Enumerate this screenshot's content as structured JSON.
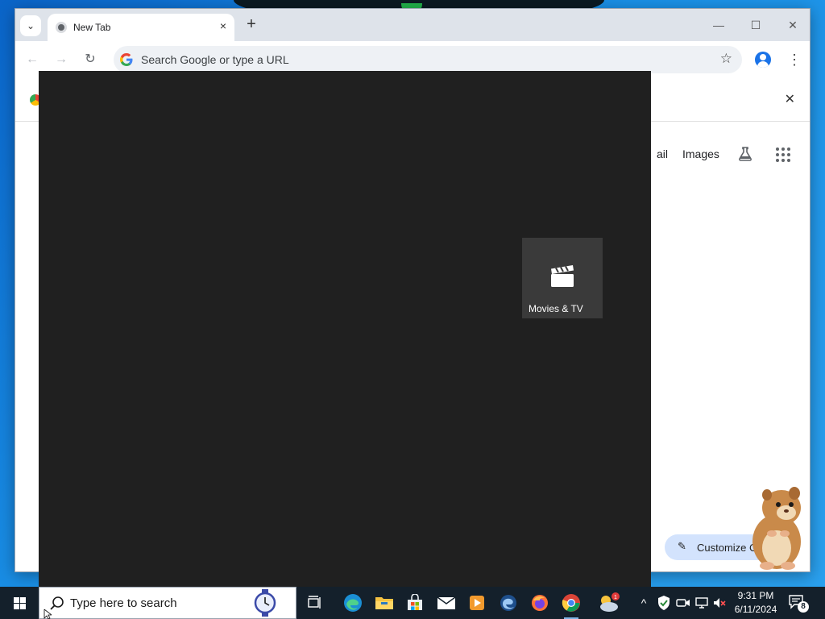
{
  "browser": {
    "tab": {
      "title": "New Tab",
      "close_glyph": "×"
    },
    "newtab_glyph": "+",
    "window_controls": {
      "minimize": "—",
      "maximize": "☐",
      "close": "✕"
    },
    "toolbar": {
      "back_glyph": "←",
      "forward_glyph": "→",
      "reload_glyph": "↻",
      "star_glyph": "☆",
      "menu_glyph": "⋮",
      "omnibox_placeholder": "Search Google or type a URL"
    },
    "page": {
      "promo_close_glyph": "✕",
      "partial_link": "ail",
      "images_link": "Images",
      "customize_label": "Customize Chr",
      "customize_glyph": "✎"
    }
  },
  "launcher": {
    "app_tile_label": "Movies & TV"
  },
  "taskbar": {
    "search_placeholder": "Type here to search",
    "clock_time": "9:31 PM",
    "clock_date": "6/11/2024",
    "notification_count": "8",
    "weather_badge": "1",
    "tray_chevron": "^"
  },
  "icons": [
    "tab-search-icon",
    "chrome-favicon",
    "google-g-icon",
    "bookmark-star-icon",
    "profile-icon",
    "kebab-menu-icon",
    "labs-flask-icon",
    "apps-grid-icon",
    "clapperboard-icon",
    "windows-logo-icon",
    "magnifier-icon",
    "task-view-icon",
    "edge-icon",
    "file-explorer-icon",
    "store-icon",
    "mail-icon",
    "media-player-icon",
    "firefox-icon",
    "chrome-icon",
    "weather-icon"
  ],
  "colors": {
    "desktop": "#1a90e6",
    "overlay": "#202020",
    "tile": "#3a3a3a",
    "taskbar": "#14202b",
    "customize_button": "#d3e3fd"
  }
}
